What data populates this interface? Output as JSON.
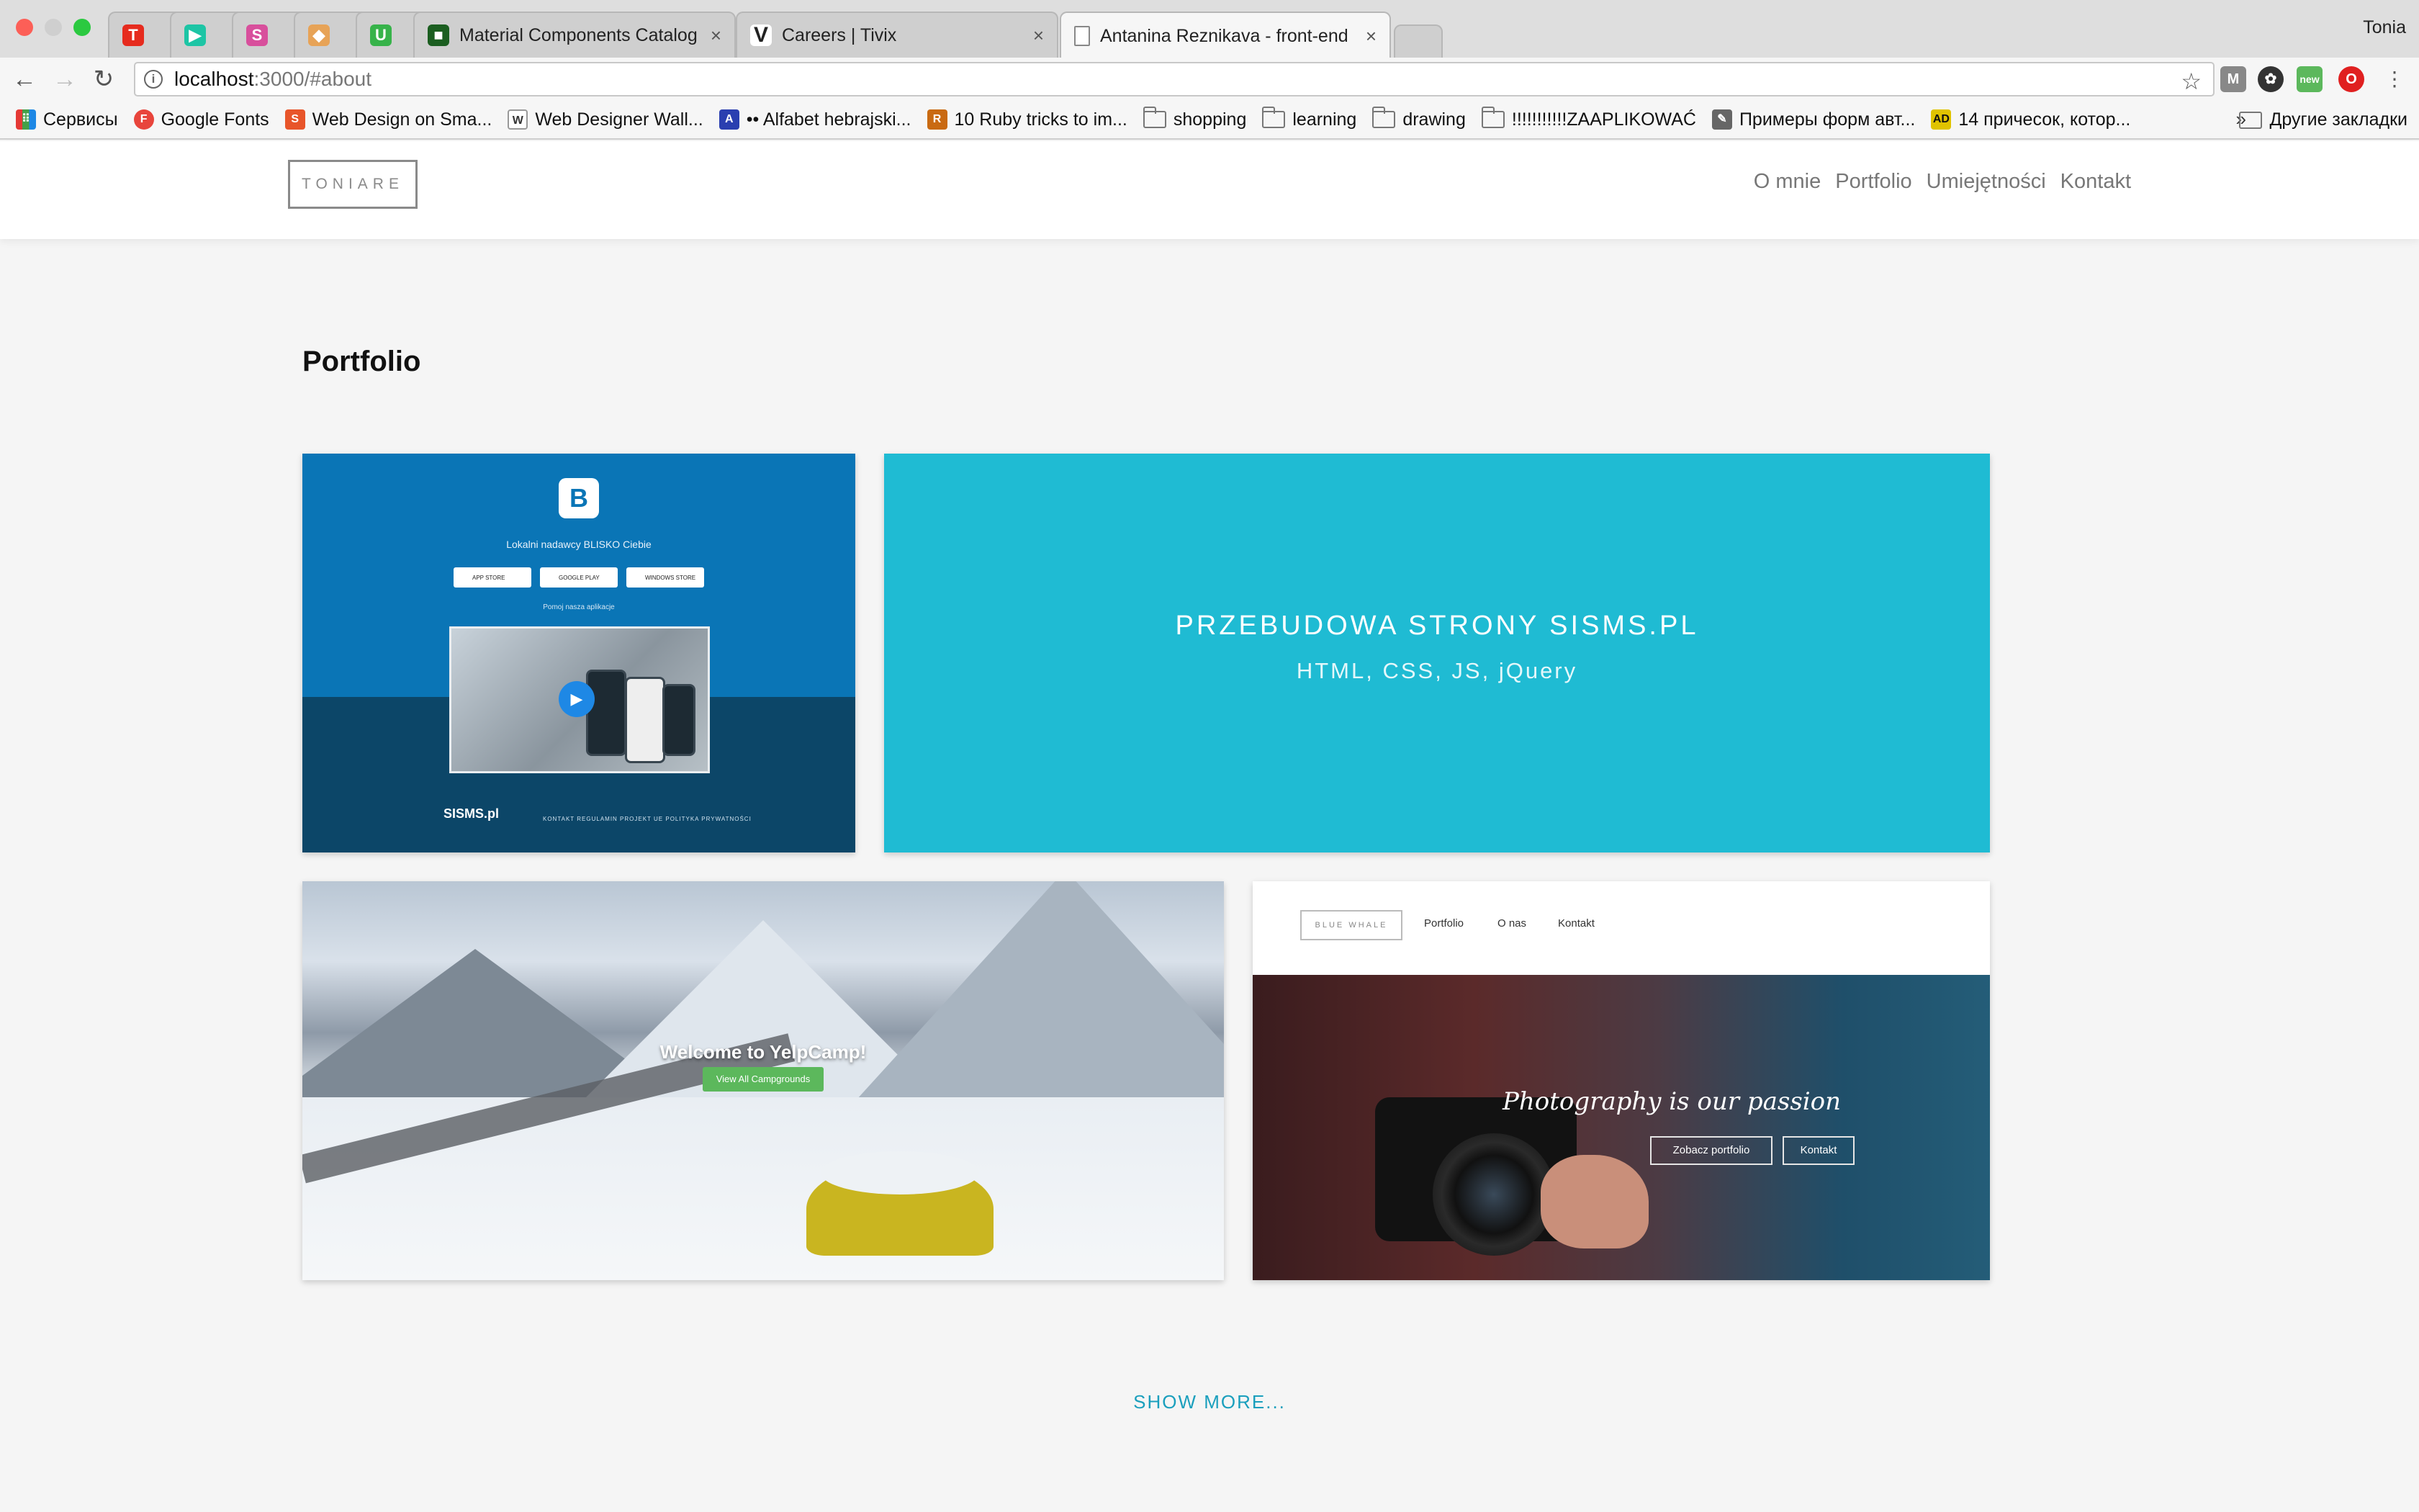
{
  "browser": {
    "tabs": [
      {
        "title": "",
        "icon": "ted-icon",
        "color": "#e62b1e",
        "glyph": "T"
      },
      {
        "title": "",
        "icon": "play-icon",
        "color": "#1dc5a5",
        "glyph": "▶"
      },
      {
        "title": "",
        "icon": "app-icon-pink",
        "color": "#d84f9c",
        "glyph": "S"
      },
      {
        "title": "",
        "icon": "app-icon-orange",
        "color": "#e7a357",
        "glyph": "◆"
      },
      {
        "title": "",
        "icon": "upwork-icon",
        "color": "#37b34a",
        "glyph": "U"
      },
      {
        "title": "Material Components Catalog",
        "icon": "material-icon",
        "color": "#1b5e20",
        "glyph": "■"
      },
      {
        "title": "Careers | Tivix",
        "icon": "tivix-icon",
        "color": "#222222",
        "glyph": "V"
      },
      {
        "title": "Antanina Reznikava - front-end",
        "icon": "page-icon",
        "color": "#888888",
        "glyph": "▯"
      }
    ],
    "user": "Tonia",
    "url_host": "localhost",
    "url_path": ":3000/#about",
    "bookmarks": [
      {
        "label": "Сервисы",
        "type": "apps"
      },
      {
        "label": "Google Fonts",
        "type": "site",
        "color": "#e8453c",
        "glyph": "F"
      },
      {
        "label": "Web Design on Sma...",
        "type": "site",
        "color": "#e8552a",
        "glyph": "S"
      },
      {
        "label": "Web Designer Wall...",
        "type": "site",
        "color": "#777777",
        "glyph": "W"
      },
      {
        "label": "•• Alfabet hebrajski...",
        "type": "site",
        "color": "#2a3fb0",
        "glyph": "A"
      },
      {
        "label": "10 Ruby tricks to im...",
        "type": "site",
        "color": "#c96a12",
        "glyph": "R"
      },
      {
        "label": "shopping",
        "type": "folder"
      },
      {
        "label": "learning",
        "type": "folder"
      },
      {
        "label": "drawing",
        "type": "folder"
      },
      {
        "label": "!!!!!!!!!!!ZAAPLIKOWAĆ",
        "type": "folder"
      },
      {
        "label": "Примеры форм авт...",
        "type": "site",
        "color": "#666666",
        "glyph": "✎"
      },
      {
        "label": "14 причесок, котор...",
        "type": "site",
        "color": "#e0c300",
        "glyph": "AD"
      }
    ],
    "bookmarks_more": "»",
    "other_bookmarks": "Другие закладки"
  },
  "site": {
    "logo": "TONIARE",
    "nav": [
      "O mnie",
      "Portfolio",
      "Umiejętności",
      "Kontakt"
    ],
    "section_title": "Portfolio",
    "show_more": "SHOW MORE...",
    "projects": {
      "sisms_preview": {
        "tagline": "Lokalni nadawcy BLISKO Ciebie",
        "stores": [
          "APP STORE",
          "GOOGLE PLAY",
          "WINDOWS STORE"
        ],
        "try_text": "Pomoj nasza aplikacje",
        "footer_logo": "SISMS.pl",
        "footer_links": "KONTAKT   REGULAMIN   PROJEKT UE   POLITYKA PRYWATNOŚCI"
      },
      "sisms_overlay": {
        "title": "PRZEBUDOWA STRONY SISMS.PL",
        "tech": "HTML, CSS, JS, jQuery"
      },
      "yelpcamp": {
        "title": "Welcome to YelpCamp!",
        "button": "View All Campgrounds"
      },
      "bluewhale": {
        "logo": "BLUE WHALE",
        "nav": [
          "Portfolio",
          "O nas",
          "Kontakt"
        ],
        "headline": "Photography is our passion",
        "buttons": [
          "Zobacz portfolio",
          "Kontakt"
        ]
      }
    }
  },
  "colors": {
    "accent": "#1fbbd3",
    "link": "#1a9fbd",
    "sisms_blue": "#0a75b6"
  }
}
